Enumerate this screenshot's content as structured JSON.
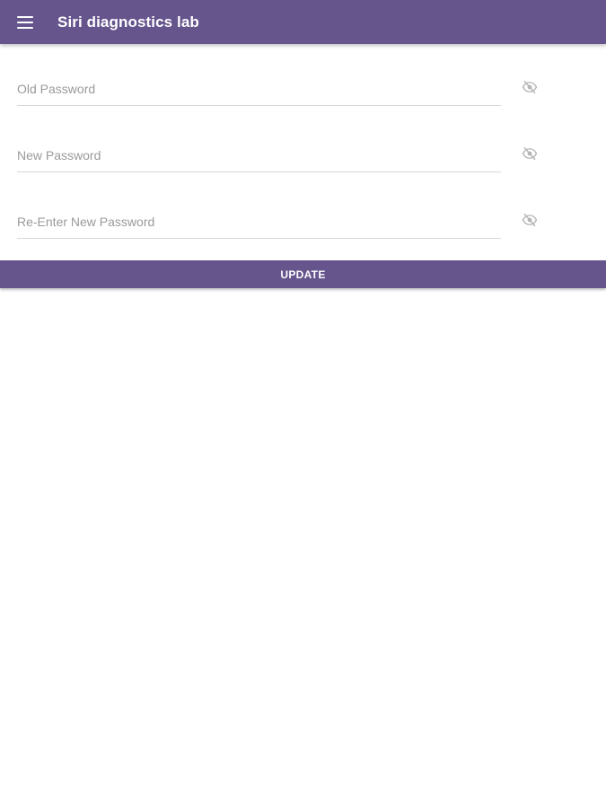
{
  "app_bar": {
    "title": "Siri diagnostics lab",
    "menu_icon": "menu-icon",
    "color": "#66548d"
  },
  "form": {
    "fields": [
      {
        "placeholder": "Old Password",
        "value": "",
        "toggle_icon": "eye-off-icon"
      },
      {
        "placeholder": "New Password",
        "value": "",
        "toggle_icon": "eye-off-icon"
      },
      {
        "placeholder": "Re-Enter New Password",
        "value": "",
        "toggle_icon": "eye-off-icon"
      }
    ]
  },
  "update_button": {
    "label": "UPDATE",
    "color": "#66548d"
  }
}
